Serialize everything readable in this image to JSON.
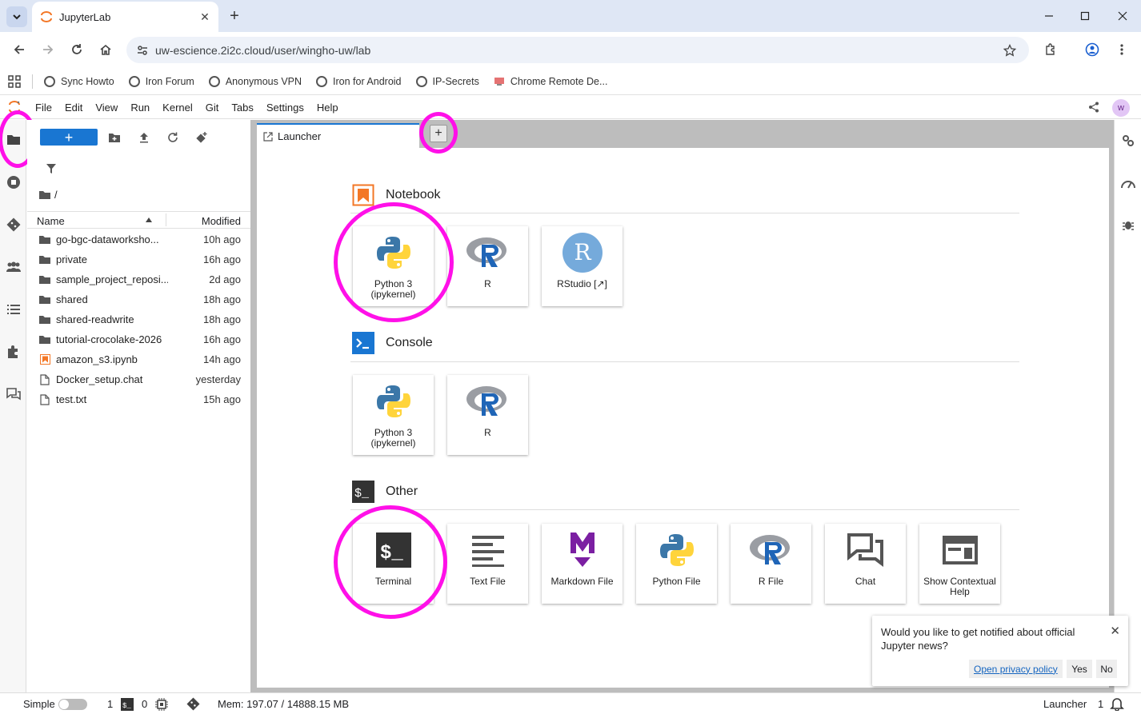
{
  "browser": {
    "tab_title": "JupyterLab",
    "url": "uw-escience.2i2c.cloud/user/wingho-uw/lab",
    "bookmarks": [
      {
        "label": "Sync Howto"
      },
      {
        "label": "Iron Forum"
      },
      {
        "label": "Anonymous VPN"
      },
      {
        "label": "Iron for Android"
      },
      {
        "label": "IP-Secrets"
      },
      {
        "label": "Chrome Remote De..."
      }
    ]
  },
  "menubar": {
    "items": [
      "File",
      "Edit",
      "View",
      "Run",
      "Kernel",
      "Git",
      "Tabs",
      "Settings",
      "Help"
    ],
    "avatar": "w"
  },
  "filebrowser": {
    "new_label": "+",
    "breadcrumb": "/",
    "col_name": "Name",
    "col_modified": "Modified",
    "files": [
      {
        "name": "go-bgc-dataworksho...",
        "modified": "10h ago",
        "kind": "folder"
      },
      {
        "name": "private",
        "modified": "16h ago",
        "kind": "folder"
      },
      {
        "name": "sample_project_reposi...",
        "modified": "2d ago",
        "kind": "folder"
      },
      {
        "name": "shared",
        "modified": "18h ago",
        "kind": "folder"
      },
      {
        "name": "shared-readwrite",
        "modified": "18h ago",
        "kind": "folder"
      },
      {
        "name": "tutorial-crocolake-2026",
        "modified": "16h ago",
        "kind": "folder"
      },
      {
        "name": "amazon_s3.ipynb",
        "modified": "14h ago",
        "kind": "notebook"
      },
      {
        "name": "Docker_setup.chat",
        "modified": "yesterday",
        "kind": "file"
      },
      {
        "name": "test.txt",
        "modified": "15h ago",
        "kind": "file"
      }
    ]
  },
  "main": {
    "tab_label": "Launcher",
    "add_tab": "+"
  },
  "launcher": {
    "notebook": {
      "heading": "Notebook",
      "cards": [
        {
          "label": "Python 3 (ipykernel)",
          "icon": "python-icon"
        },
        {
          "label": "R",
          "icon": "r-icon"
        },
        {
          "label": "RStudio [↗]",
          "icon": "rstudio-icon"
        }
      ]
    },
    "console": {
      "heading": "Console",
      "cards": [
        {
          "label": "Python 3 (ipykernel)",
          "icon": "python-icon"
        },
        {
          "label": "R",
          "icon": "r-icon"
        }
      ]
    },
    "other": {
      "heading": "Other",
      "cards": [
        {
          "label": "Terminal",
          "icon": "terminal-icon"
        },
        {
          "label": "Text File",
          "icon": "text-file-icon"
        },
        {
          "label": "Markdown File",
          "icon": "markdown-icon"
        },
        {
          "label": "Python File",
          "icon": "python-icon"
        },
        {
          "label": "R File",
          "icon": "r-icon"
        },
        {
          "label": "Chat",
          "icon": "chat-icon"
        },
        {
          "label": "Show Contextual Help",
          "icon": "contextual-help-icon"
        }
      ]
    }
  },
  "notification": {
    "message": "Would you like to get notified about official Jupyter news?",
    "policy_link": "Open privacy policy",
    "yes": "Yes",
    "no": "No"
  },
  "statusbar": {
    "mode": "Simple",
    "terminals_count": "1",
    "kernels_count": "0",
    "memory": "Mem: 197.07 / 14888.15 MB",
    "active_tab": "Launcher",
    "notifications_count": "1"
  },
  "colors": {
    "accent": "#1976d2",
    "highlight_ring": "#ff10e8",
    "notebook_orange": "#f37726"
  }
}
